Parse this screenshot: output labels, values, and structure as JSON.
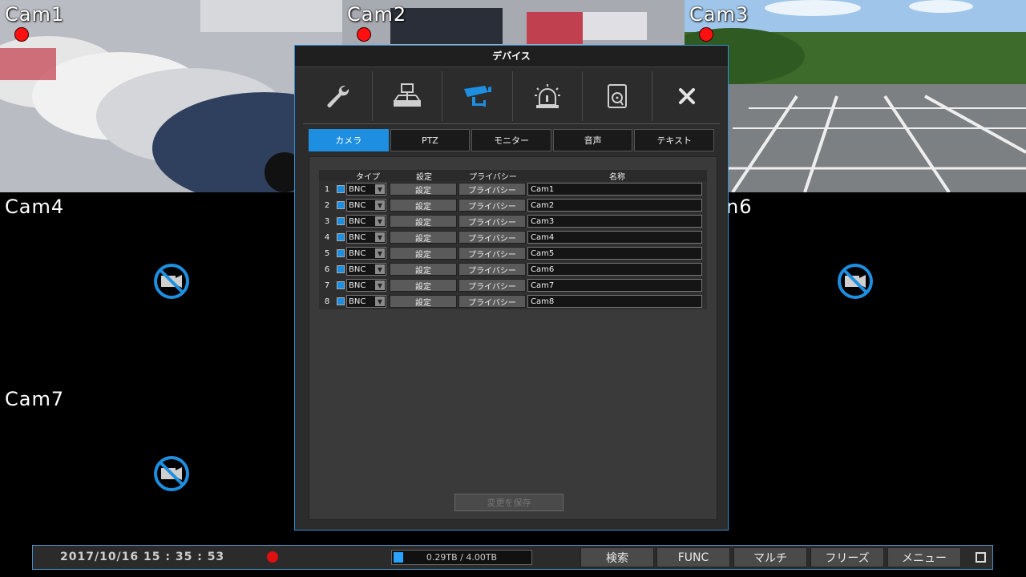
{
  "cameras": [
    {
      "label": "Cam1",
      "recording": true,
      "has_feed": true
    },
    {
      "label": "Cam2",
      "recording": true,
      "has_feed": true
    },
    {
      "label": "Cam3",
      "recording": true,
      "has_feed": true
    },
    {
      "label": "Cam4",
      "recording": false,
      "has_feed": false
    },
    {
      "label": "n6",
      "recording": false,
      "has_feed": false
    },
    {
      "label": "Cam7",
      "recording": false,
      "has_feed": false
    }
  ],
  "dialog": {
    "title": "デバイス",
    "icons": [
      "wrench-icon",
      "network-icon",
      "camera-icon",
      "alarm-icon",
      "storage-icon",
      "close-icon"
    ],
    "tabs": [
      {
        "label": "カメラ",
        "active": true
      },
      {
        "label": "PTZ",
        "active": false
      },
      {
        "label": "モニター",
        "active": false
      },
      {
        "label": "音声",
        "active": false
      },
      {
        "label": "テキスト",
        "active": false
      }
    ],
    "columns": {
      "type": "タイプ",
      "settings": "設定",
      "privacy": "プライバシー",
      "name": "名称"
    },
    "rows": [
      {
        "num": "1",
        "type": "BNC",
        "settings": "設定",
        "privacy": "プライバシー",
        "name": "Cam1"
      },
      {
        "num": "2",
        "type": "BNC",
        "settings": "設定",
        "privacy": "プライバシー",
        "name": "Cam2"
      },
      {
        "num": "3",
        "type": "BNC",
        "settings": "設定",
        "privacy": "プライバシー",
        "name": "Cam3"
      },
      {
        "num": "4",
        "type": "BNC",
        "settings": "設定",
        "privacy": "プライバシー",
        "name": "Cam4"
      },
      {
        "num": "5",
        "type": "BNC",
        "settings": "設定",
        "privacy": "プライバシー",
        "name": "Cam5"
      },
      {
        "num": "6",
        "type": "BNC",
        "settings": "設定",
        "privacy": "プライバシー",
        "name": "Cam6"
      },
      {
        "num": "7",
        "type": "BNC",
        "settings": "設定",
        "privacy": "プライバシー",
        "name": "Cam7"
      },
      {
        "num": "8",
        "type": "BNC",
        "settings": "設定",
        "privacy": "プライバシー",
        "name": "Cam8"
      }
    ],
    "save_label": "変更を保存"
  },
  "bottombar": {
    "datetime": "2017/10/16  15 : 35 : 53",
    "storage_text": "0.29TB / 4.00TB",
    "storage_used_fraction": 0.0725,
    "buttons": [
      "検索",
      "FUNC",
      "マルチ",
      "フリーズ",
      "メニュー"
    ]
  },
  "colors": {
    "accent": "#1e8fe0",
    "record": "#ff1010"
  }
}
